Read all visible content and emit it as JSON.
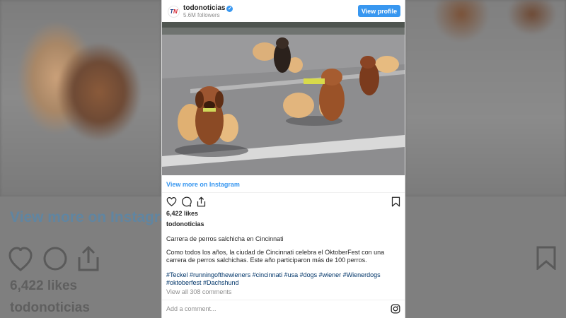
{
  "header": {
    "username": "todonoticias",
    "followers": "5.6M followers",
    "view_profile": "View profile"
  },
  "post": {
    "view_more": "View more on Instagram",
    "likes": "6,422 likes",
    "account": "todonoticias",
    "caption_title": "Carrera de perros salchicha en Cincinnati",
    "caption_body": "Como todos los años, la ciudad de Cincinnati celebra el OktoberFest con una carrera de perros salchichas. Este año participaron más de 100 perros.",
    "hashtags": "#Teckel #runningofthewieners #cincinnati #usa #dogs #wiener #Wienerdogs #oktoberfest #Dachshund",
    "comments_link": "View all 308 comments",
    "comment_placeholder": "Add a comment..."
  },
  "backdrop": {
    "view_more": "View more on Instagram",
    "likes": "6,422 likes",
    "account": "todonoticias"
  },
  "colors": {
    "accent": "#3897f0",
    "text": "#262626",
    "muted": "#8e8e8e",
    "hashtag": "#003569"
  },
  "icons": [
    "heart-icon",
    "comment-icon",
    "share-icon",
    "bookmark-icon",
    "instagram-icon",
    "verified-icon"
  ]
}
